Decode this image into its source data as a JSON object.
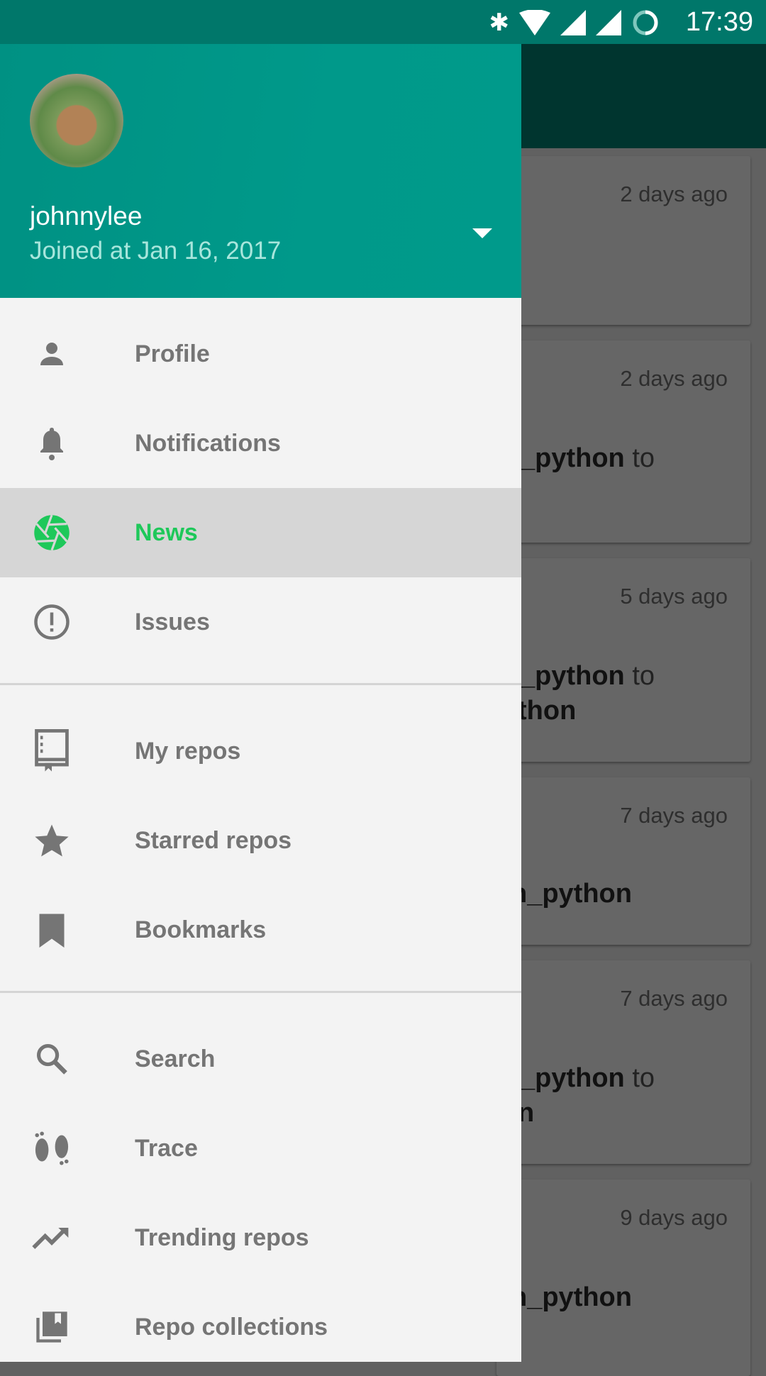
{
  "status_bar": {
    "time": "17:39",
    "icons": [
      "bluetooth-icon",
      "wifi-icon",
      "signal-icon",
      "signal-icon",
      "battery-saver-icon"
    ]
  },
  "drawer": {
    "user": {
      "name": "johnnylee",
      "joined": "Joined at Jan 16, 2017"
    },
    "groups": [
      [
        {
          "label": "Profile",
          "icon": "person-icon"
        },
        {
          "label": "Notifications",
          "icon": "bell-icon"
        },
        {
          "label": "News",
          "icon": "aperture-icon",
          "selected": true
        },
        {
          "label": "Issues",
          "icon": "alert-circle-icon"
        }
      ],
      [
        {
          "label": "My repos",
          "icon": "repo-book-icon"
        },
        {
          "label": "Starred repos",
          "icon": "star-icon"
        },
        {
          "label": "Bookmarks",
          "icon": "bookmark-icon"
        }
      ],
      [
        {
          "label": "Search",
          "icon": "search-icon"
        },
        {
          "label": "Trace",
          "icon": "footprints-icon"
        },
        {
          "label": "Trending repos",
          "icon": "trending-up-icon"
        },
        {
          "label": "Repo collections",
          "icon": "collections-icon"
        }
      ]
    ],
    "accent": "#1ec85a"
  },
  "feed": [
    {
      "when": "2 days ago",
      "lines": []
    },
    {
      "when": "2 days ago",
      "lines": [
        {
          "b": "_python",
          "n": " to"
        }
      ]
    },
    {
      "when": "5 days ago",
      "lines": [
        {
          "b": "_python",
          "n": " to"
        },
        {
          "b": "thon",
          "n": ""
        }
      ]
    },
    {
      "when": "7 days ago",
      "lines": [
        {
          "b": "n_python",
          "n": ""
        }
      ]
    },
    {
      "when": "7 days ago",
      "lines": [
        {
          "b": "_python",
          "n": " to"
        },
        {
          "b": "n",
          "n": ""
        }
      ]
    },
    {
      "when": "9 days ago",
      "lines": [
        {
          "b": "n_python",
          "n": ""
        }
      ]
    }
  ]
}
